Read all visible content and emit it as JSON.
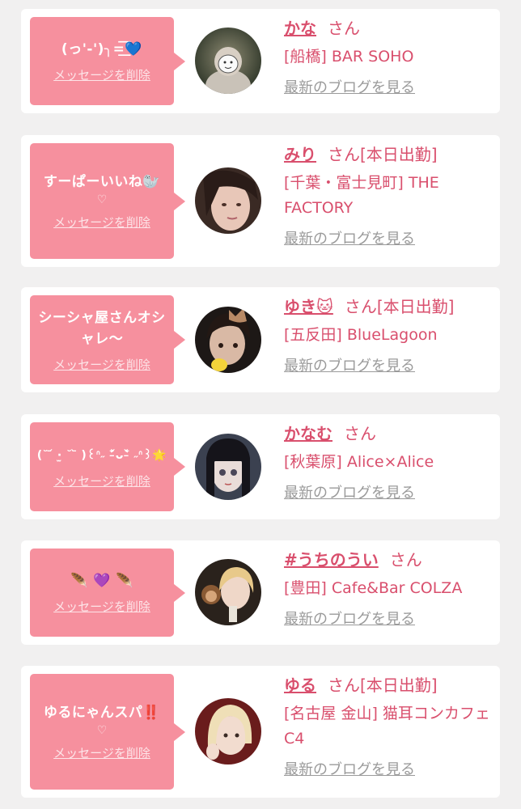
{
  "cards": [
    {
      "message": "(っ'-')╮=͟͟͞͞💙",
      "heart": "",
      "delete_label": "メッセージを削除",
      "name": "かな",
      "honorific": "さん",
      "status": "",
      "shop": "[船橋] BAR SOHO",
      "blog_label": "最新のブログを見る"
    },
    {
      "message": "すーぱーいいね🦭",
      "heart": "♡",
      "delete_label": "メッセージを削除",
      "name": "みり",
      "honorific": "さん",
      "status": "[本日出勤]",
      "shop": "[千葉・富士見町] THE FACTORY",
      "blog_label": "最新のブログを見る"
    },
    {
      "message": "シーシャ屋さんオシャレ〜",
      "heart": "",
      "delete_label": "メッセージを削除",
      "name": "ゆき🐱",
      "honorific": "さん",
      "status": "[本日出勤]",
      "shop": "[五反田] BlueLagoon",
      "blog_label": "最新のブログを見る"
    },
    {
      "message": "(˘ ᷄ ·̫ ˘ ᷅ )꒰ᐢ˶ ˃̵᷄ᴗ˂̵᷅ ˶ᐢ꒱🌟",
      "heart": "",
      "delete_label": "メッセージを削除",
      "name": "かなむ",
      "honorific": "さん",
      "status": "",
      "shop": "[秋葉原] Alice×Alice",
      "blog_label": "最新のブログを見る"
    },
    {
      "message": "🪶 💜 🪶",
      "heart": "",
      "delete_label": "メッセージを削除",
      "name": "#うちのうい",
      "honorific": "さん",
      "status": "",
      "shop": "[豊田] Cafe&Bar COLZA",
      "blog_label": "最新のブログを見る"
    },
    {
      "message": "ゆるにゃんスパ‼️",
      "heart": "♡",
      "delete_label": "メッセージを削除",
      "name": "ゆる",
      "honorific": "さん",
      "status": "[本日出勤]",
      "shop": "[名古屋 金山] 猫耳コンカフェ C4",
      "blog_label": "最新のブログを見る"
    }
  ],
  "colors": {
    "accent": "#d94f6d",
    "bubble": "#f6909e",
    "background": "#f1f0f0",
    "muted_link": "#9a9a9a"
  }
}
